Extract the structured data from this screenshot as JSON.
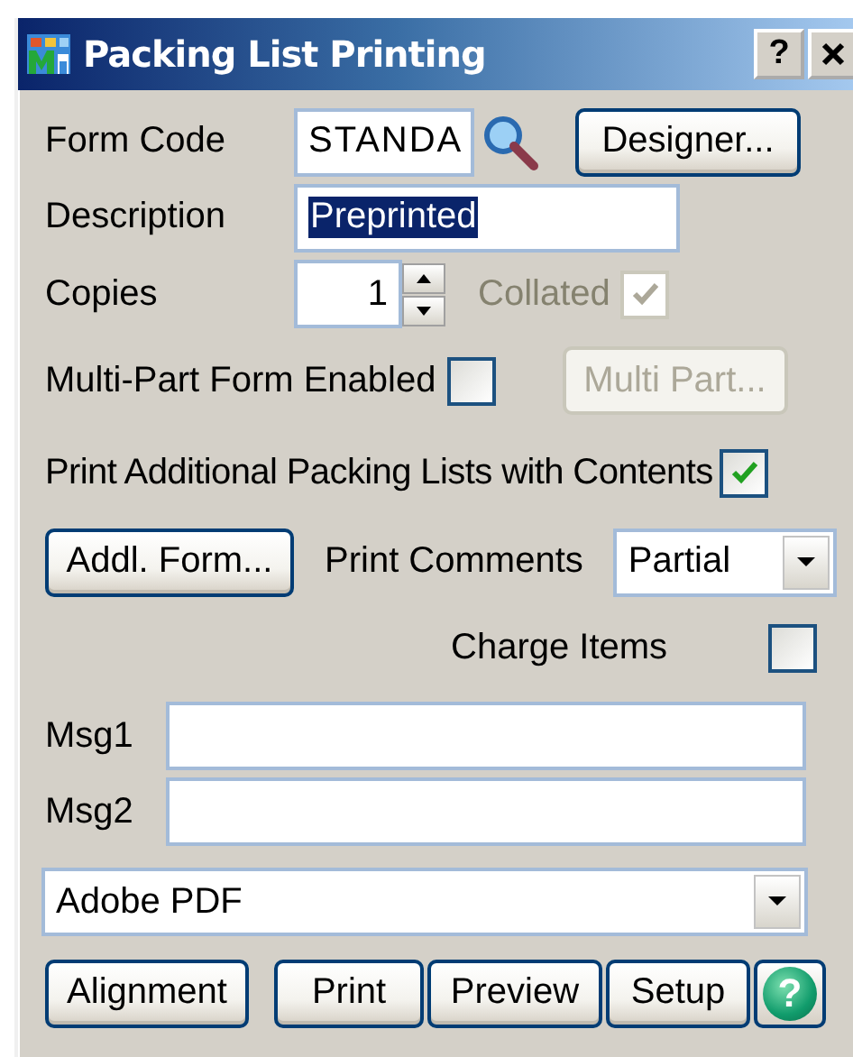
{
  "window": {
    "title": "Packing List Printing",
    "help_label": "?"
  },
  "form_code": {
    "label": "Form Code",
    "value": "STANDA"
  },
  "designer_button": {
    "label": "Designer...",
    "disabled": false
  },
  "description": {
    "label": "Description",
    "value": "Preprinted",
    "selected": true
  },
  "copies": {
    "label": "Copies",
    "value": "1"
  },
  "collated": {
    "label": "Collated",
    "checked": true,
    "disabled": true
  },
  "multi_part": {
    "label": "Multi-Part Form Enabled",
    "checked": false
  },
  "multi_part_button": {
    "label": "Multi Part...",
    "disabled": true
  },
  "print_additional": {
    "label": "Print Additional Packing Lists with Contents",
    "checked": true
  },
  "addl_form_button": {
    "label": "Addl. Form...",
    "disabled": false
  },
  "print_comments": {
    "label": "Print Comments",
    "value": "Partial"
  },
  "charge_items": {
    "label": "Charge Items",
    "checked": false
  },
  "msg1": {
    "label": "Msg1"
  },
  "msg2": {
    "label": "Msg2"
  },
  "printer": {
    "value": "Adobe PDF"
  },
  "buttons": [
    {
      "label": "Alignment",
      "disabled": false
    },
    {
      "label": "Print",
      "disabled": false
    },
    {
      "label": "Preview",
      "disabled": false
    },
    {
      "label": "Setup",
      "disabled": false
    }
  ],
  "help_button": {
    "label": "?"
  }
}
